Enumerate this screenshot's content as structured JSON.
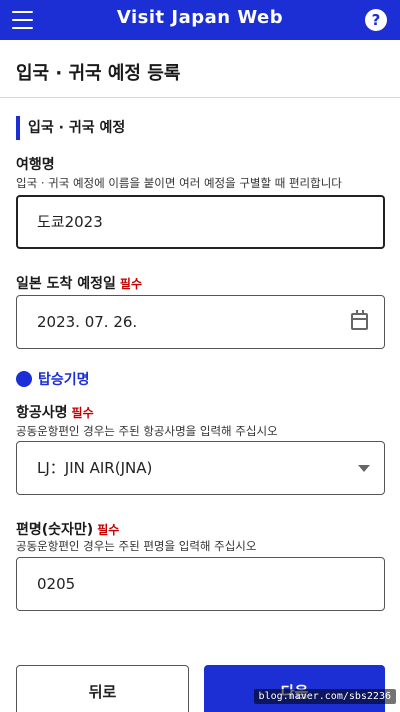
{
  "app_bar": {
    "title": "Visit Japan Web",
    "help_label": "?"
  },
  "page": {
    "title": "입국 · 귀국 예정 등록"
  },
  "section": {
    "title": "입국 · 귀국 예정"
  },
  "fields": {
    "trip_name": {
      "label": "여행명",
      "hint": "입국 · 귀국 예정에 이름을 붙이면 여러 예정을 구별할 때 편리합니다",
      "value": "도쿄2023"
    },
    "arrival_date": {
      "label": "일본 도착 예정일",
      "required": "필수",
      "value": "2023. 07. 26."
    },
    "flight_section": {
      "title": "탑승기명"
    },
    "airline": {
      "label": "항공사명",
      "required": "필수",
      "hint": "공동운항편인 경우는 주된 항공사명을 입력해 주십시오",
      "value": "LJ：JIN AIR(JNA)"
    },
    "flight_number": {
      "label": "편명(숫자만)",
      "required": "필수",
      "hint": "공동운항편인 경우는 주된 편명을 입력해 주십시오",
      "value": "0205"
    }
  },
  "buttons": {
    "back": "뒤로",
    "next": "다음"
  },
  "watermark": "blog.naver.com/sbs2236",
  "colors": {
    "brand": "#1c2fd4",
    "required": "#c40000"
  }
}
